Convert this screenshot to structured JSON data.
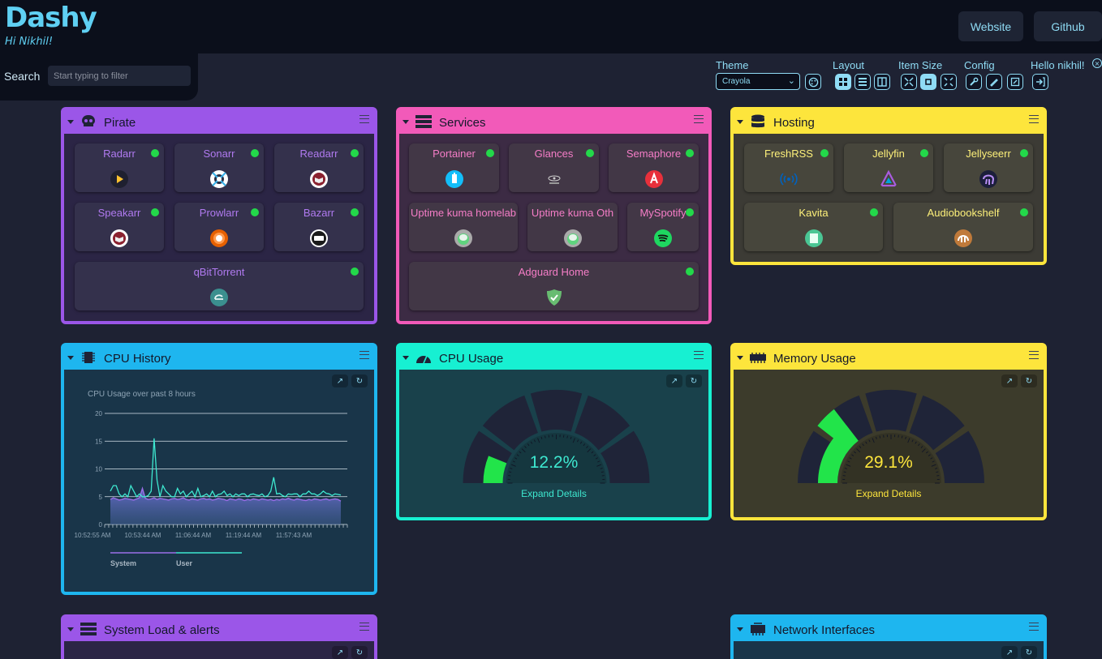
{
  "header": {
    "title": "Dashy",
    "subtitle": "Hi Nikhil!",
    "links": [
      {
        "label": "Website"
      },
      {
        "label": "Github"
      }
    ]
  },
  "search": {
    "label": "Search",
    "placeholder": "Start typing to filter"
  },
  "settings": {
    "theme_label": "Theme",
    "theme_value": "Crayola",
    "layout_label": "Layout",
    "item_size_label": "Item Size",
    "config_label": "Config",
    "user_label": "Hello nikhil!"
  },
  "colors": {
    "purple": "#9b56e8",
    "pink": "#f25ab9",
    "yellow": "#fde53c",
    "cyan": "#1eb6ef",
    "teal": "#17f0d2",
    "status_online": "#23d84a",
    "gauge_fill": "#22e44a"
  },
  "sections": {
    "pirate": {
      "title": "Pirate",
      "icon": "skull-icon",
      "items": [
        {
          "label": "Radarr",
          "icon": "radarr-icon"
        },
        {
          "label": "Sonarr",
          "icon": "sonarr-icon"
        },
        {
          "label": "Readarr",
          "icon": "readarr-icon"
        },
        {
          "label": "Speakarr",
          "icon": "speakarr-icon"
        },
        {
          "label": "Prowlarr",
          "icon": "prowlarr-icon"
        },
        {
          "label": "Bazarr",
          "icon": "bazarr-icon"
        },
        {
          "label": "qBitTorrent",
          "icon": "qbittorrent-icon"
        }
      ]
    },
    "services": {
      "title": "Services",
      "icon": "server-icon",
      "items": [
        {
          "label": "Portainer",
          "icon": "portainer-icon"
        },
        {
          "label": "Glances",
          "icon": "glances-icon"
        },
        {
          "label": "Semaphore",
          "icon": "semaphore-icon"
        },
        {
          "label": "Uptime kuma homelab",
          "icon": "uptime-kuma-icon"
        },
        {
          "label": "Uptime kuma Oth",
          "icon": "uptime-kuma-icon"
        },
        {
          "label": "MySpotify",
          "icon": "spotify-icon"
        },
        {
          "label": "Adguard Home",
          "icon": "adguard-icon"
        }
      ]
    },
    "hosting": {
      "title": "Hosting",
      "icon": "database-icon",
      "items": [
        {
          "label": "FreshRSS",
          "icon": "freshrss-icon"
        },
        {
          "label": "Jellyfin",
          "icon": "jellyfin-icon"
        },
        {
          "label": "Jellyseerr",
          "icon": "jellyseerr-icon"
        },
        {
          "label": "Kavita",
          "icon": "kavita-icon"
        },
        {
          "label": "Audiobookshelf",
          "icon": "audiobookshelf-icon"
        }
      ]
    },
    "cpu_history": {
      "title": "CPU History",
      "icon": "cpu-chip-icon"
    },
    "cpu_usage": {
      "title": "CPU Usage",
      "icon": "speedometer-icon",
      "value": "12.2%",
      "fraction": 0.122,
      "link": "Expand Details"
    },
    "memory_usage": {
      "title": "Memory Usage",
      "icon": "memory-icon",
      "value": "29.1%",
      "fraction": 0.291,
      "link": "Expand Details"
    },
    "system_load": {
      "title": "System Load & alerts",
      "icon": "server-icon"
    },
    "network": {
      "title": "Network Interfaces",
      "icon": "network-icon"
    }
  },
  "chart_data": {
    "type": "area",
    "title": "CPU Usage over past 8 hours",
    "x_tick_labels": [
      "10:52:55 AM",
      "10:53:44 AM",
      "11:06:44 AM",
      "11:19:44 AM",
      "11:57:43 AM"
    ],
    "y_ticks": [
      0,
      5,
      10,
      15,
      20
    ],
    "ylim": [
      0,
      20
    ],
    "grid": true,
    "legend_position": "bottom-left",
    "series": [
      {
        "name": "System",
        "color": "#9b6ee8",
        "values": [
          4.5,
          4.8,
          4.6,
          4.4,
          4.5,
          4.7,
          4.6,
          4.5,
          4.4,
          4.6,
          4.8,
          6.5,
          4.7,
          4.5,
          4.6,
          4.8,
          4.5,
          4.7,
          4.6,
          4.5,
          4.4,
          4.6,
          4.7,
          4.5,
          4.6,
          4.8,
          4.5,
          4.4,
          4.6,
          4.5,
          4.4,
          4.6,
          4.7,
          4.5,
          4.6,
          4.4,
          4.5,
          4.7,
          4.6,
          4.5,
          4.3,
          4.6,
          4.5,
          4.4,
          4.6,
          4.5,
          4.3,
          4.5,
          4.4,
          4.6,
          4.5,
          4.4,
          4.6,
          4.5,
          4.4,
          4.5,
          4.3,
          4.5,
          4.4,
          4.6,
          4.5,
          4.7,
          4.5,
          4.4,
          4.6,
          4.5,
          4.4,
          4.3,
          4.5,
          4.4,
          4.6,
          4.5,
          4.4,
          4.5,
          4.6,
          4.4,
          4.5,
          4.6,
          4.5,
          4.2
        ]
      },
      {
        "name": "User",
        "color": "#3ee8d0",
        "values": [
          6,
          7,
          7,
          5.5,
          5,
          5.5,
          5,
          7,
          6,
          5,
          5.5,
          5,
          5,
          5.2,
          6,
          15.5,
          8,
          5,
          7,
          6,
          5.5,
          5,
          5,
          6.5,
          5.5,
          6,
          5,
          5.5,
          6,
          5,
          6.5,
          5,
          5.2,
          5.5,
          5,
          6,
          5,
          5.4,
          5.5,
          6,
          5.2,
          5.5,
          5,
          5.5,
          5.2,
          5.5,
          5.5,
          5,
          5.4,
          5.5,
          5.3,
          5.2,
          5.5,
          5,
          5.2,
          6,
          8.5,
          5.5,
          5.6,
          5.2,
          5,
          5.5,
          5.4,
          5.5,
          5.5,
          5,
          5.5,
          5.5,
          6,
          5.5,
          5.5,
          5.2,
          5.5,
          6,
          5.6,
          5.5,
          5.2,
          5.5,
          5.4,
          5.3
        ]
      }
    ]
  }
}
